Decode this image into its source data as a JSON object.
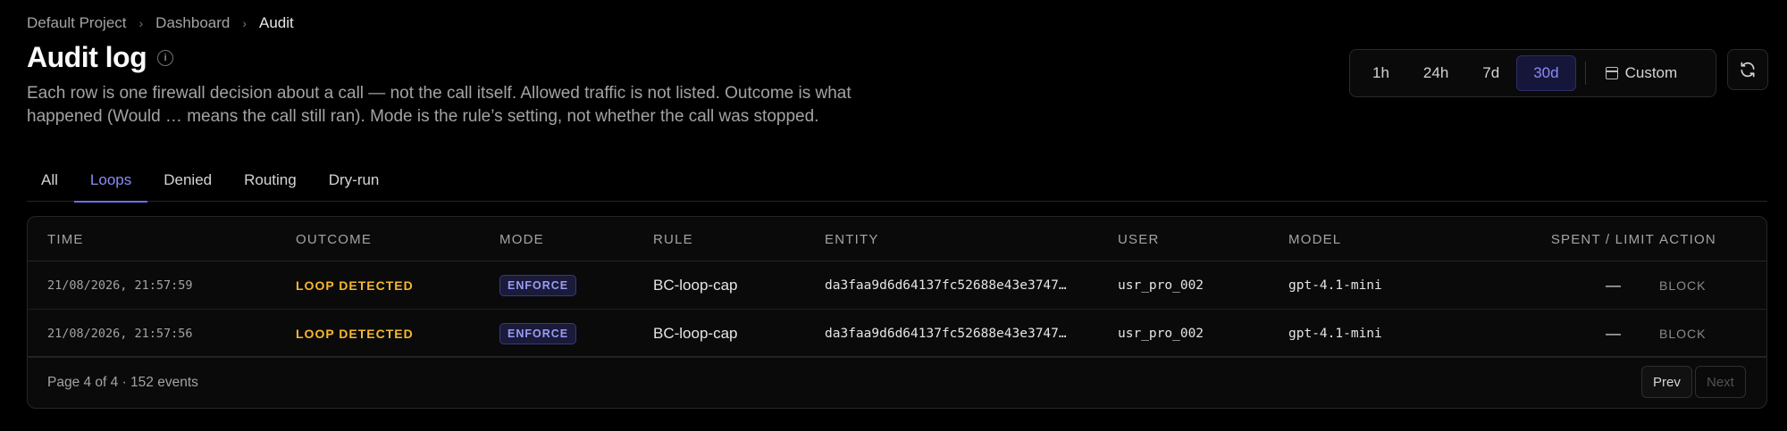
{
  "breadcrumb": [
    "Default Project",
    "Dashboard",
    "Audit"
  ],
  "page": {
    "title": "Audit log",
    "description": "Each row is one firewall decision about a call — not the call itself. Allowed traffic is not listed. Outcome is what happened (Would … means the call still ran). Mode is the rule’s setting, not whether the call was stopped."
  },
  "time_range": {
    "options": [
      "1h",
      "24h",
      "7d",
      "30d"
    ],
    "selected": "30d",
    "custom_label": "Custom"
  },
  "tabs": [
    "All",
    "Loops",
    "Denied",
    "Routing",
    "Dry-run"
  ],
  "active_tab": "Loops",
  "table": {
    "headers": [
      "TIME",
      "OUTCOME",
      "MODE",
      "RULE",
      "ENTITY",
      "USER",
      "MODEL",
      "SPENT / LIMIT",
      "ACTION"
    ],
    "rows": [
      {
        "time": "21/08/2026, 21:57:59",
        "outcome": "LOOP DETECTED",
        "mode": "ENFORCE",
        "rule": "BC-loop-cap",
        "entity": "da3faa9d6d64137fc52688e43e3747…",
        "user": "usr_pro_002",
        "model": "gpt-4.1-mini",
        "spent": "—",
        "action": "BLOCK"
      },
      {
        "time": "21/08/2026, 21:57:56",
        "outcome": "LOOP DETECTED",
        "mode": "ENFORCE",
        "rule": "BC-loop-cap",
        "entity": "da3faa9d6d64137fc52688e43e3747…",
        "user": "usr_pro_002",
        "model": "gpt-4.1-mini",
        "spent": "—",
        "action": "BLOCK"
      }
    ]
  },
  "pagination": {
    "info": "Page 4 of 4 · 152 events",
    "prev_label": "Prev",
    "next_label": "Next"
  },
  "colors": {
    "accent": "#6d6df2",
    "outcome_warning": "#f5b82e",
    "background": "#000000"
  }
}
